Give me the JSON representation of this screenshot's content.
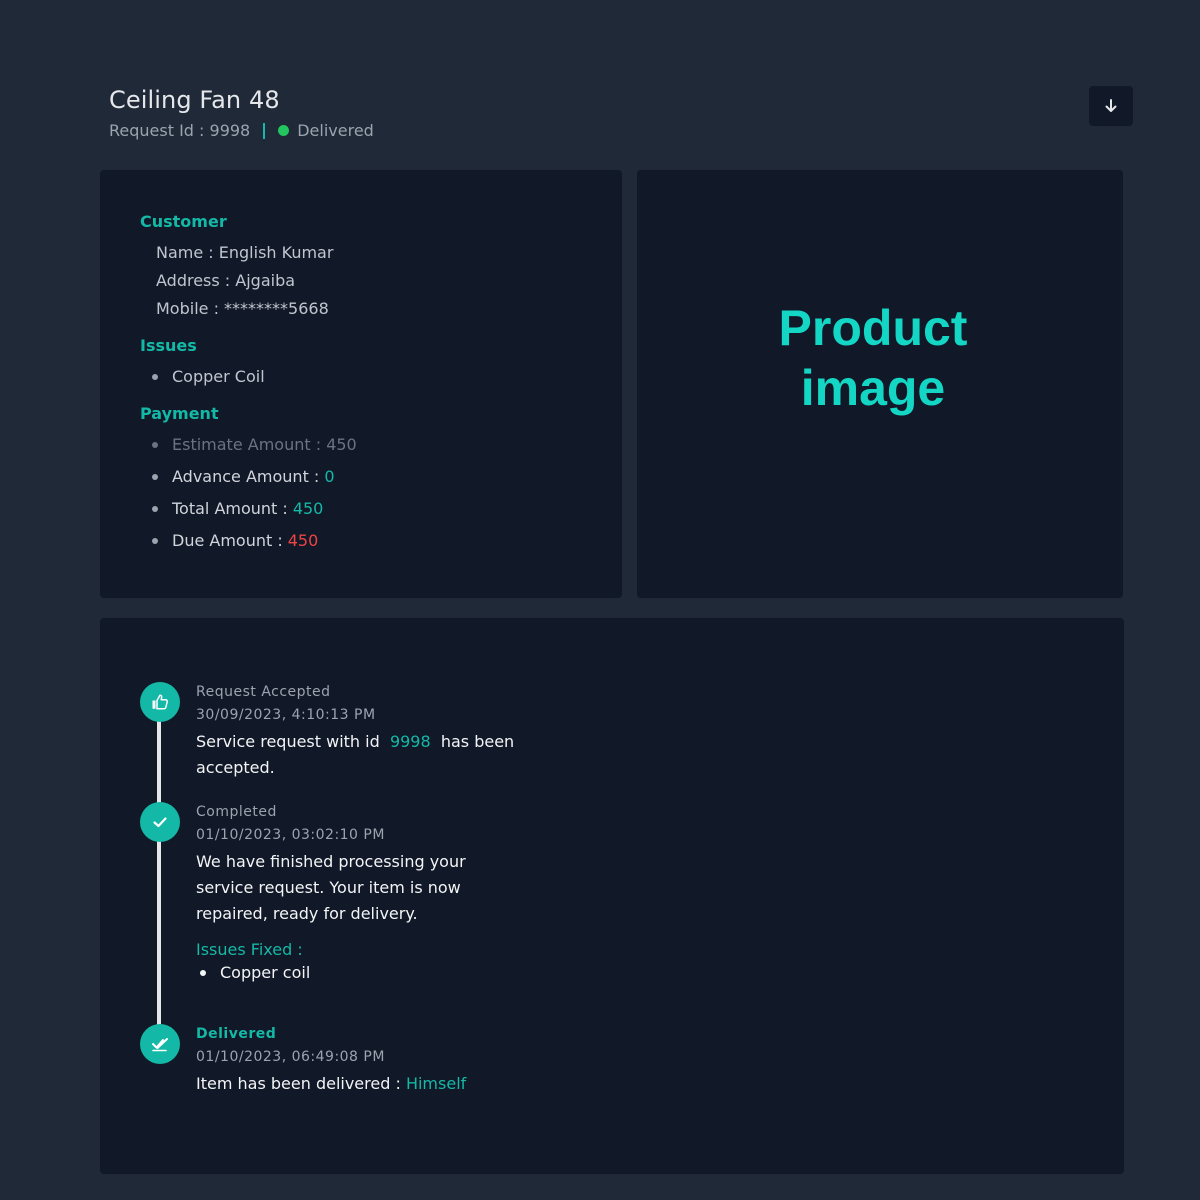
{
  "header": {
    "title": "Ceiling Fan 48",
    "request_id_label": "Request Id : 9998",
    "status": "Delivered",
    "status_color": "#22c55e",
    "download_icon": "arrow-down-icon"
  },
  "customer": {
    "section_title": "Customer",
    "name": "Name : English Kumar",
    "address": "Address : Ajgaiba",
    "mobile": "Mobile : ********5668"
  },
  "issues": {
    "section_title": "Issues",
    "items": [
      "Copper Coil"
    ]
  },
  "payment": {
    "section_title": "Payment",
    "estimate_label": "Estimate Amount : 450",
    "advance_label": "Advance Amount :",
    "advance_value": "0",
    "total_label": "Total Amount :",
    "total_value": "450",
    "due_label": "Due Amount :",
    "due_value": "450"
  },
  "product_image": {
    "placeholder_line1": "Product",
    "placeholder_line2": "image"
  },
  "timeline": {
    "events": [
      {
        "title": "Request Accepted",
        "date": "30/09/2023, 4:10:13 PM",
        "desc_prefix": "Service request with id",
        "desc_id": "9998",
        "desc_suffix": "has been",
        "desc_line2": "accepted.",
        "icon": "thumbs-up-icon"
      },
      {
        "title": "Completed",
        "date": "01/10/2023, 03:02:10 PM",
        "desc_line1": "We have finished processing your",
        "desc_line2": "service request. Your item is now",
        "desc_line3": "repaired, ready for delivery.",
        "fixed_title": "Issues Fixed :",
        "fixed_items": [
          "Copper coil"
        ],
        "icon": "check-icon"
      },
      {
        "title": "Delivered",
        "date": "01/10/2023, 06:49:08 PM",
        "desc_prefix": "Item has been delivered :",
        "desc_value": "Himself",
        "icon": "double-check-icon"
      }
    ]
  },
  "colors": {
    "accent": "#14b8a6",
    "danger": "#ef4444",
    "background": "#1f2937",
    "card": "#111827"
  }
}
